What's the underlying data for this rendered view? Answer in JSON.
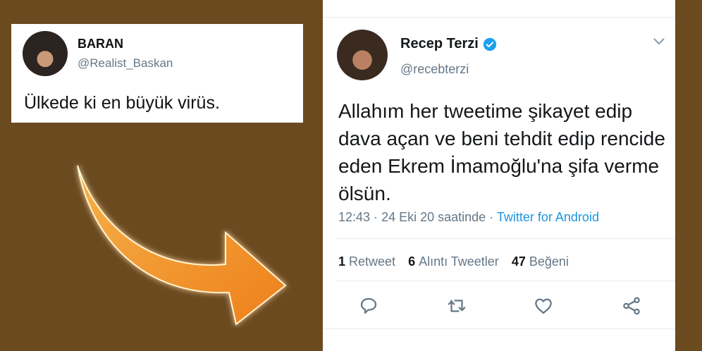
{
  "left_tweet": {
    "name": "BARAN",
    "handle": "@Realist_Baskan",
    "text": "Ülkede ki en büyük virüs."
  },
  "right_tweet": {
    "name": "Recep Terzi",
    "handle": "@recebterzi",
    "text": "Allahım her tweetime şikayet edip dava açan ve beni tehdit edip rencide eden Ekrem İmamoğlu'na şifa verme ölsün.",
    "time": "12:43",
    "dot1": "·",
    "date": "24 Eki 20 saatinde",
    "dot2": "·",
    "source": "Twitter for Android",
    "stats": [
      {
        "count": "1",
        "label": "Retweet"
      },
      {
        "count": "6",
        "label": "Alıntı Tweetler"
      },
      {
        "count": "47",
        "label": "Beğeni"
      }
    ],
    "actions": [
      "reply-icon",
      "retweet-icon",
      "like-icon",
      "share-icon"
    ]
  },
  "colors": {
    "background": "#6b4a20",
    "link": "#1b95e0",
    "muted": "#657786",
    "verified": "#1da1f2",
    "arrow": "#f39a2a"
  }
}
